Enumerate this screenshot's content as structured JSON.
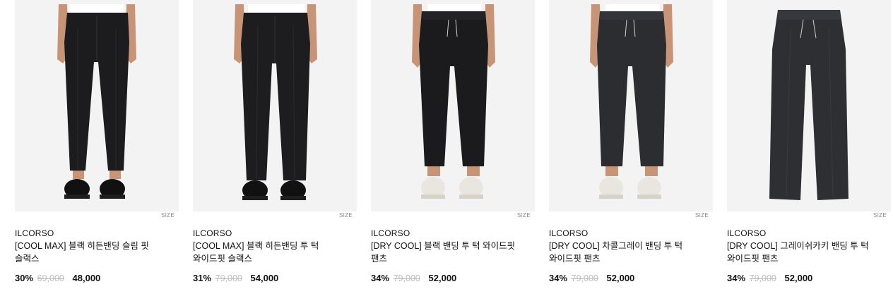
{
  "products": [
    {
      "image_icon": "black-slim-slacks-image",
      "size_tag": "SIZE",
      "brand": "ILCORSO",
      "name": "[COOL MAX] 블랙 히든밴딩 슬림 핏 슬랙스",
      "discount": "30%",
      "original_price": "69,000",
      "sale_price": "48,000",
      "pants_color": "#1c1c1e",
      "shoe_color": "#111111"
    },
    {
      "image_icon": "black-wide-slacks-image",
      "size_tag": "SIZE",
      "brand": "ILCORSO",
      "name": "[COOL MAX] 블랙 히든밴딩 투 턱 와이드핏 슬랙스",
      "discount": "31%",
      "original_price": "79,000",
      "sale_price": "54,000",
      "pants_color": "#1d1d1f",
      "shoe_color": "#111111"
    },
    {
      "image_icon": "black-banding-pants-image",
      "size_tag": "SIZE",
      "brand": "ILCORSO",
      "name": "[DRY COOL] 블랙 밴딩 투 턱 와이드핏 팬츠",
      "discount": "34%",
      "original_price": "79,000",
      "sale_price": "52,000",
      "pants_color": "#1b1b1d",
      "shoe_color": "#e9e6df"
    },
    {
      "image_icon": "charcoal-banding-pants-image",
      "size_tag": "SIZE",
      "brand": "ILCORSO",
      "name": "[DRY COOL] 차콜그레이 밴딩 투 턱 와이드핏 팬츠",
      "discount": "34%",
      "original_price": "79,000",
      "sale_price": "52,000",
      "pants_color": "#2b2d31",
      "shoe_color": "#e9e6df"
    },
    {
      "image_icon": "gray-khaki-banding-pants-image",
      "size_tag": "SIZE",
      "brand": "ILCORSO",
      "name": "[DRY COOL] 그레이쉬카키 밴딩 투 턱 와이드핏 팬츠",
      "discount": "34%",
      "original_price": "79,000",
      "sale_price": "52,000",
      "pants_color": "#2e2f33",
      "shoe_color": ""
    }
  ],
  "colors": {
    "image_bg": "#f3f3f3",
    "original_price": "#bdbdbd",
    "text": "#111111"
  }
}
